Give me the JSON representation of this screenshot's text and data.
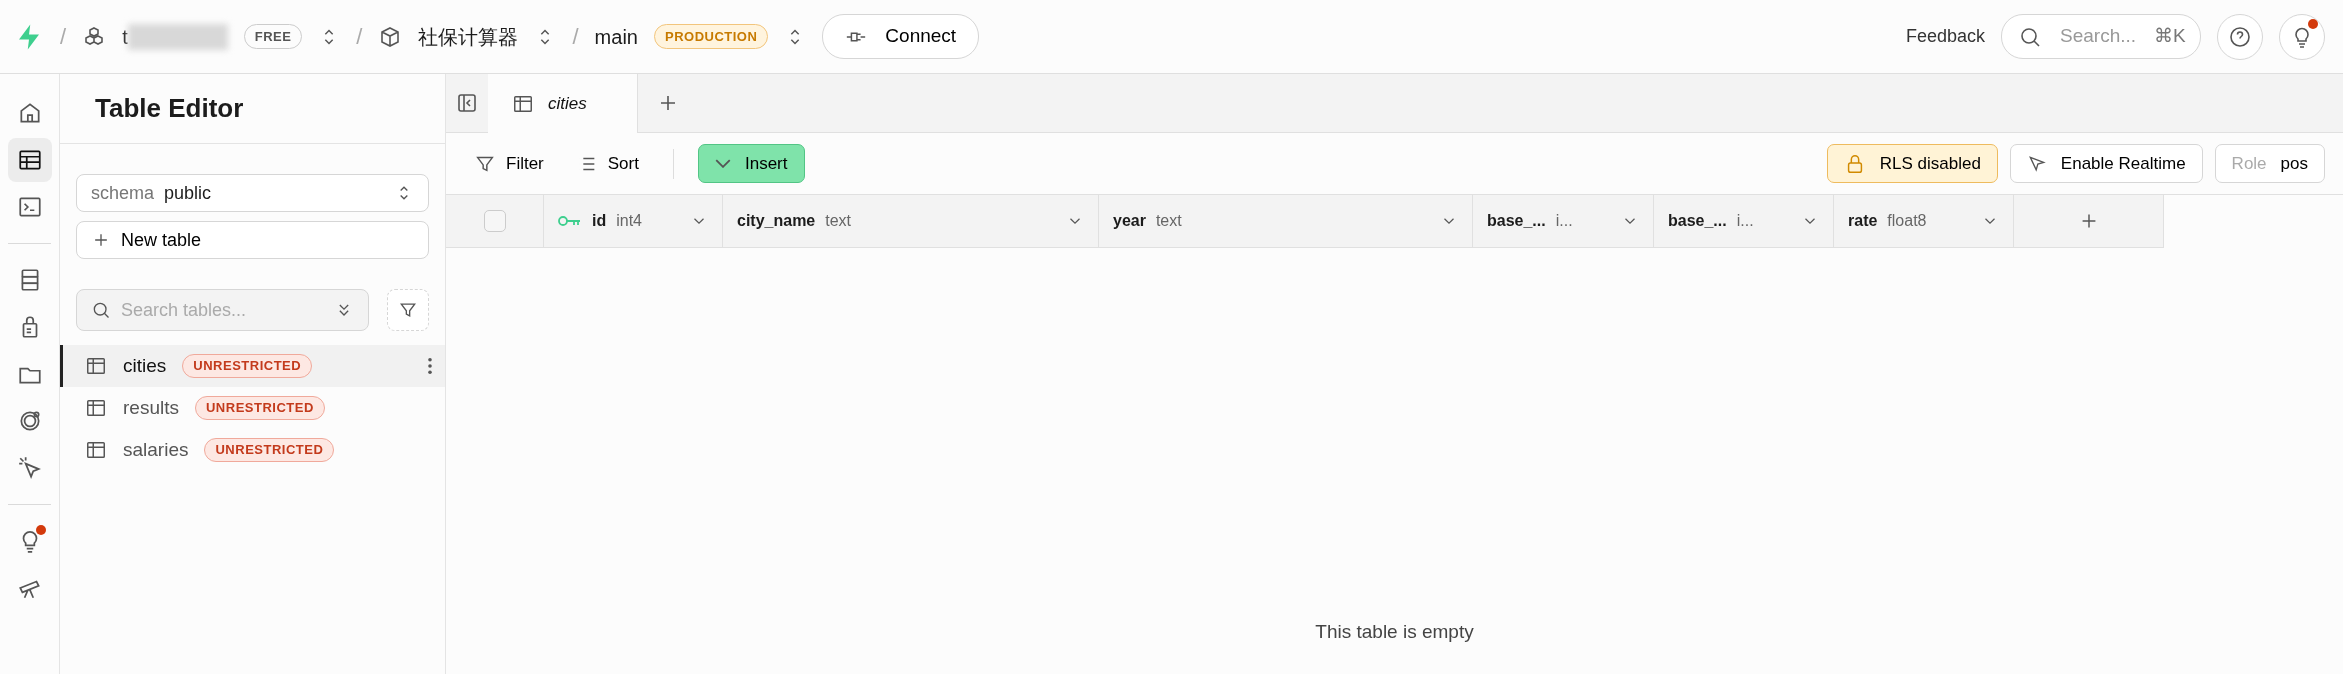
{
  "topbar": {
    "separators": [
      "/",
      "/",
      "/"
    ],
    "org": {
      "name": "t",
      "plan": "FREE"
    },
    "project": {
      "name": "社保计算器"
    },
    "branch": {
      "name": "main",
      "env": "PRODUCTION"
    },
    "connect": "Connect",
    "feedback": "Feedback",
    "search": {
      "placeholder": "Search...",
      "shortcut": "⌘K"
    },
    "notification": true
  },
  "rail": [
    {
      "kind": "home",
      "selected": false
    },
    {
      "kind": "table",
      "selected": true
    },
    {
      "kind": "sql",
      "selected": false
    },
    {
      "kind": "database",
      "selected": false
    },
    {
      "kind": "auth",
      "selected": false
    },
    {
      "kind": "storage",
      "selected": false
    },
    {
      "kind": "realtime",
      "selected": false
    },
    {
      "kind": "advisor",
      "selected": false
    },
    {
      "kind": "tip",
      "selected": false,
      "notification": true
    },
    {
      "kind": "telescope",
      "selected": false
    }
  ],
  "sidebar": {
    "title": "Table Editor",
    "schema": {
      "label": "schema",
      "value": "public"
    },
    "new_table": "New table",
    "search": {
      "placeholder": "Search tables..."
    },
    "tables": [
      {
        "name": "cities",
        "badge": "UNRESTRICTED",
        "selected": true
      },
      {
        "name": "results",
        "badge": "UNRESTRICTED",
        "selected": false
      },
      {
        "name": "salaries",
        "badge": "UNRESTRICTED",
        "selected": false
      }
    ]
  },
  "tabs": [
    {
      "label": "cities",
      "selected": true
    }
  ],
  "toolbar": {
    "filter": "Filter",
    "sort": "Sort",
    "insert": "Insert",
    "rls": "RLS disabled",
    "realtime": "Enable Realtime",
    "role": {
      "label": "Role",
      "value": "pos"
    }
  },
  "table": {
    "select_all_checked": false,
    "columns": [
      {
        "name": "id",
        "type": "int4",
        "primary_key": true
      },
      {
        "name": "city_name",
        "type": "text",
        "primary_key": false
      },
      {
        "name": "year",
        "type": "text",
        "primary_key": false
      },
      {
        "name": "base_...",
        "type": "i...",
        "primary_key": false
      },
      {
        "name": "base_...",
        "type": "i...",
        "primary_key": false
      },
      {
        "name": "rate",
        "type": "float8",
        "primary_key": false
      }
    ],
    "empty_message": "This table is empty"
  }
}
